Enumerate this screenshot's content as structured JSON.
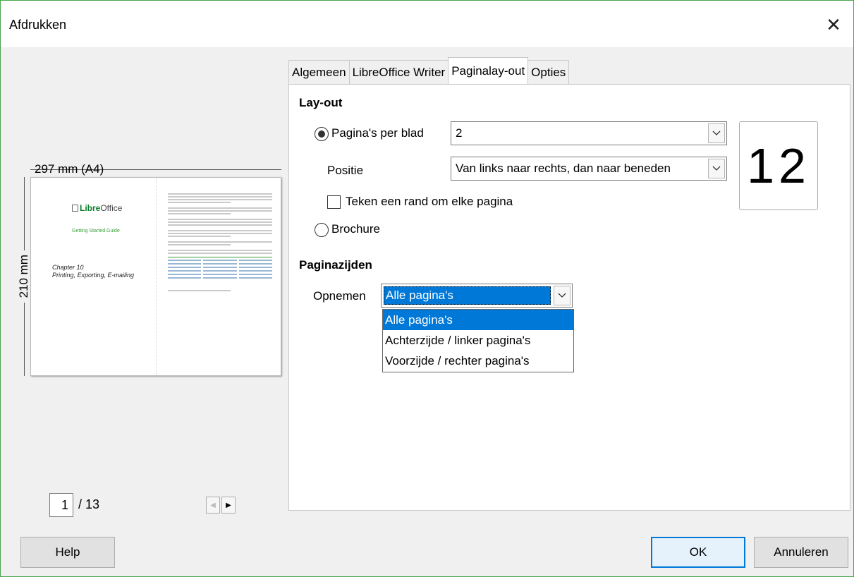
{
  "window": {
    "title": "Afdrukken",
    "close_symbol": "✕"
  },
  "preview": {
    "width_label": "297 mm (A4)",
    "height_label": "210 mm",
    "doc_logo": "LibreOffice",
    "doc_logo_prefix": "Libre",
    "doc_logo_suffix": "Office",
    "doc_subtitle": "Getting Started Guide",
    "doc_chapter": "Chapter 10",
    "doc_chapter_title": "Printing, Exporting, E-mailing",
    "current_page": "1",
    "total_pages": "/ 13"
  },
  "tabs": [
    {
      "label": "Algemeen",
      "active": false
    },
    {
      "label": "LibreOffice Writer",
      "active": false
    },
    {
      "label": "Paginalay-out",
      "active": true
    },
    {
      "label": "Opties",
      "active": false
    }
  ],
  "layout": {
    "section_title": "Lay-out",
    "pages_per_sheet_label": "Pagina's per blad",
    "pages_per_sheet_value": "2",
    "position_label": "Positie",
    "position_value": "Van links naar rechts, dan naar beneden",
    "border_checkbox_label": "Teken een rand om elke pagina",
    "border_checked": false,
    "brochure_label": "Brochure",
    "preview_text": "12"
  },
  "sides": {
    "section_title": "Paginazijden",
    "include_label": "Opnemen",
    "include_value": "Alle pagina's",
    "options": [
      "Alle pagina's",
      "Achterzijde / linker pagina's",
      "Voorzijde / rechter pagina's"
    ],
    "selected_index": 0
  },
  "buttons": {
    "help": "Help",
    "ok": "OK",
    "cancel": "Annuleren"
  },
  "colors": {
    "accent": "#0078d7",
    "window_border": "#4aa54a"
  }
}
